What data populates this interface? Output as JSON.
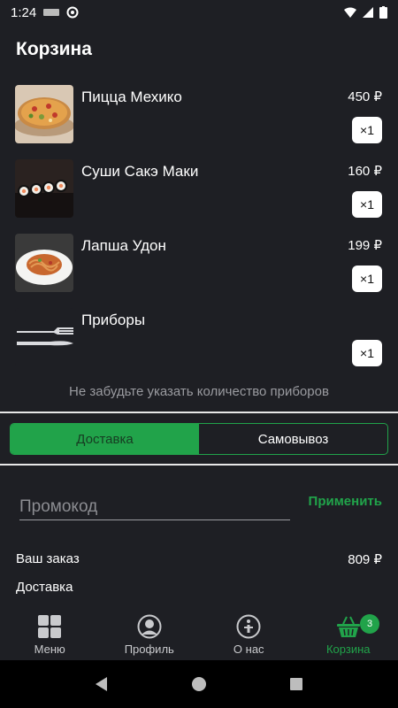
{
  "status_bar": {
    "time": "1:24"
  },
  "page": {
    "title": "Корзина"
  },
  "cart": {
    "items": [
      {
        "name": "Пицца Мехико",
        "price": "450 ₽",
        "qty": "×1",
        "image": "pizza"
      },
      {
        "name": "Суши Сакэ Маки",
        "price": "160 ₽",
        "qty": "×1",
        "image": "sushi"
      },
      {
        "name": "Лапша Удон",
        "price": "199 ₽",
        "qty": "×1",
        "image": "noodles"
      },
      {
        "name": "Приборы",
        "price": "",
        "qty": "×1",
        "image": "cutlery"
      }
    ],
    "cutlery_hint": "Не забудьте указать количество приборов"
  },
  "delivery_toggle": {
    "options": [
      "Доставка",
      "Самовывоз"
    ],
    "selected": "Доставка"
  },
  "promo": {
    "placeholder": "Промокод",
    "value": "",
    "apply_label": "Применить"
  },
  "summary": {
    "order_label": "Ваш заказ",
    "order_value": "809 ₽",
    "delivery_label": "Доставка"
  },
  "bottom_nav": {
    "items": [
      {
        "label": "Меню",
        "icon": "grid-icon"
      },
      {
        "label": "Профиль",
        "icon": "profile-icon"
      },
      {
        "label": "О нас",
        "icon": "about-icon"
      },
      {
        "label": "Корзина",
        "icon": "basket-icon",
        "badge": "3",
        "active": true
      }
    ]
  },
  "colors": {
    "accent": "#21a34a",
    "background": "#1e1f24",
    "muted": "#9a9ba0"
  }
}
